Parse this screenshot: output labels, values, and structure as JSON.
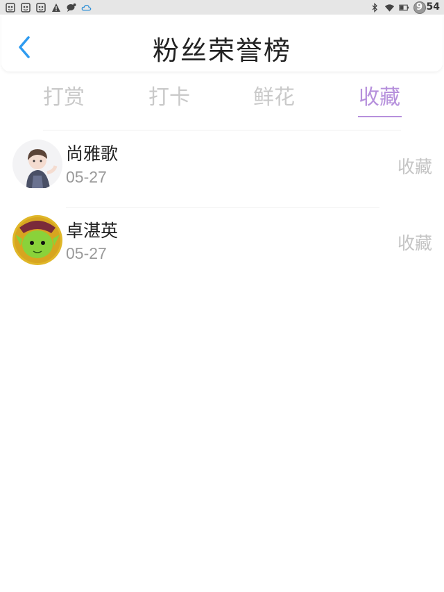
{
  "status_bar": {
    "left_icons": [
      "app-icon",
      "app-icon",
      "app-icon",
      "warning-icon",
      "chat-icon",
      "cloud-icon"
    ],
    "time": "9:54",
    "time_hour": "9",
    "time_rest": "54"
  },
  "header": {
    "title": "粉丝荣誉榜"
  },
  "tabs": [
    {
      "label": "打赏"
    },
    {
      "label": "打卡"
    },
    {
      "label": "鲜花"
    },
    {
      "label": "收藏"
    }
  ],
  "active_tab_index": 3,
  "colors": {
    "accent": "#b690dc",
    "back_arrow": "#2e9bf0",
    "inactive_tab": "#c9c9c9"
  },
  "list": [
    {
      "name": "尚雅歌",
      "date": "05-27",
      "type": "收藏",
      "avatar": "girl-avatar"
    },
    {
      "name": "卓湛英",
      "date": "05-27",
      "type": "收藏",
      "avatar": "green-monster-avatar"
    }
  ]
}
